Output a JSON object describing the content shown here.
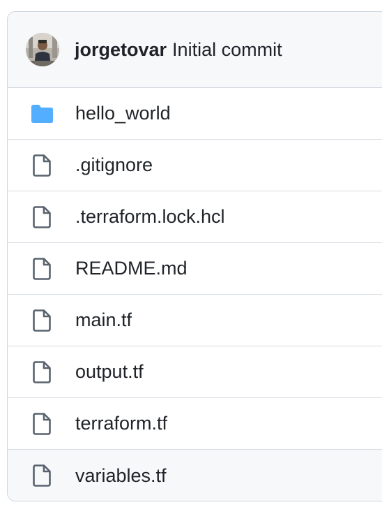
{
  "commit": {
    "author": "jorgetovar",
    "message": "Initial commit"
  },
  "files": [
    {
      "name": "hello_world",
      "type": "folder",
      "icon": "folder-icon"
    },
    {
      "name": ".gitignore",
      "type": "file",
      "icon": "file-icon"
    },
    {
      "name": ".terraform.lock.hcl",
      "type": "file",
      "icon": "file-icon"
    },
    {
      "name": "README.md",
      "type": "file",
      "icon": "file-icon"
    },
    {
      "name": "main.tf",
      "type": "file",
      "icon": "file-icon"
    },
    {
      "name": "output.tf",
      "type": "file",
      "icon": "file-icon"
    },
    {
      "name": "terraform.tf",
      "type": "file",
      "icon": "file-icon"
    },
    {
      "name": "variables.tf",
      "type": "file",
      "icon": "file-icon"
    }
  ],
  "colors": {
    "folder": "#54aeff",
    "file_outline": "#59636e",
    "border": "#d0d7de",
    "header_bg": "#f6f8fa"
  }
}
